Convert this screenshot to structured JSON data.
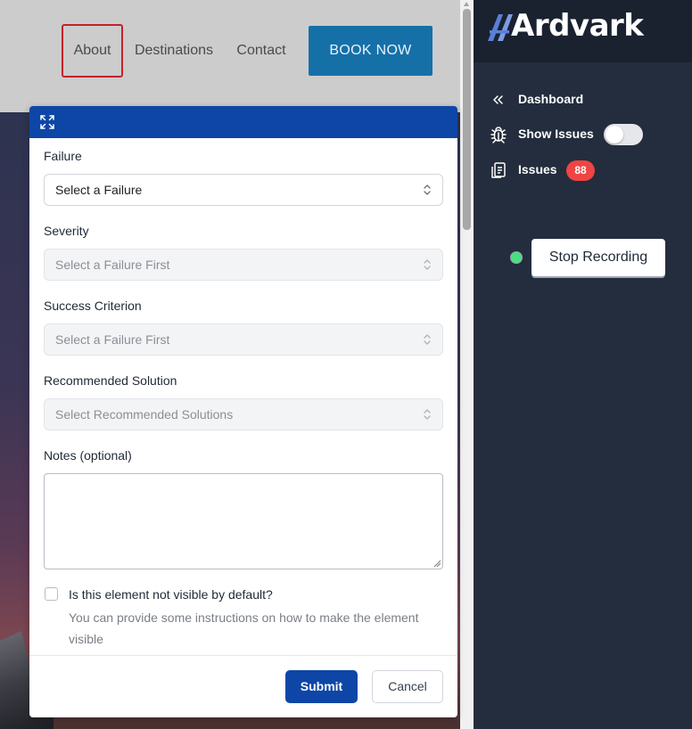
{
  "site": {
    "nav": {
      "about": "About",
      "destinations": "Destinations",
      "contact": "Contact",
      "book": "BOOK NOW"
    }
  },
  "form": {
    "failure": {
      "label": "Failure",
      "value": "Select a Failure"
    },
    "severity": {
      "label": "Severity",
      "value": "Select a Failure First"
    },
    "success_criterion": {
      "label": "Success Criterion",
      "value": "Select a Failure First"
    },
    "solution": {
      "label": "Recommended Solution",
      "value": "Select Recommended Solutions"
    },
    "notes": {
      "label": "Notes (optional)",
      "value": ""
    },
    "visible": {
      "label": "Is this element not visible by default?",
      "help": "You can provide some instructions on how to make the element visible",
      "checked": false
    },
    "submit": "Submit",
    "cancel": "Cancel"
  },
  "panel": {
    "brand": "Ardvark",
    "dashboard": "Dashboard",
    "show_issues": "Show Issues",
    "show_issues_on": false,
    "issues": "Issues",
    "issues_count": "88",
    "stop_recording": "Stop Recording"
  },
  "colors": {
    "primary": "#0e46a7",
    "panel_bg": "#232d3d",
    "badge": "#ef4444",
    "recording": "#4ade80",
    "book_button": "#1670a8",
    "focus_outline": "#c3222a"
  },
  "icons": {
    "expand": "expand-icon",
    "select": "chevron-up-down-icon",
    "dashboard": "double-chevron-left-icon",
    "show_issues": "bug-icon",
    "issues": "clipboard-icon"
  }
}
